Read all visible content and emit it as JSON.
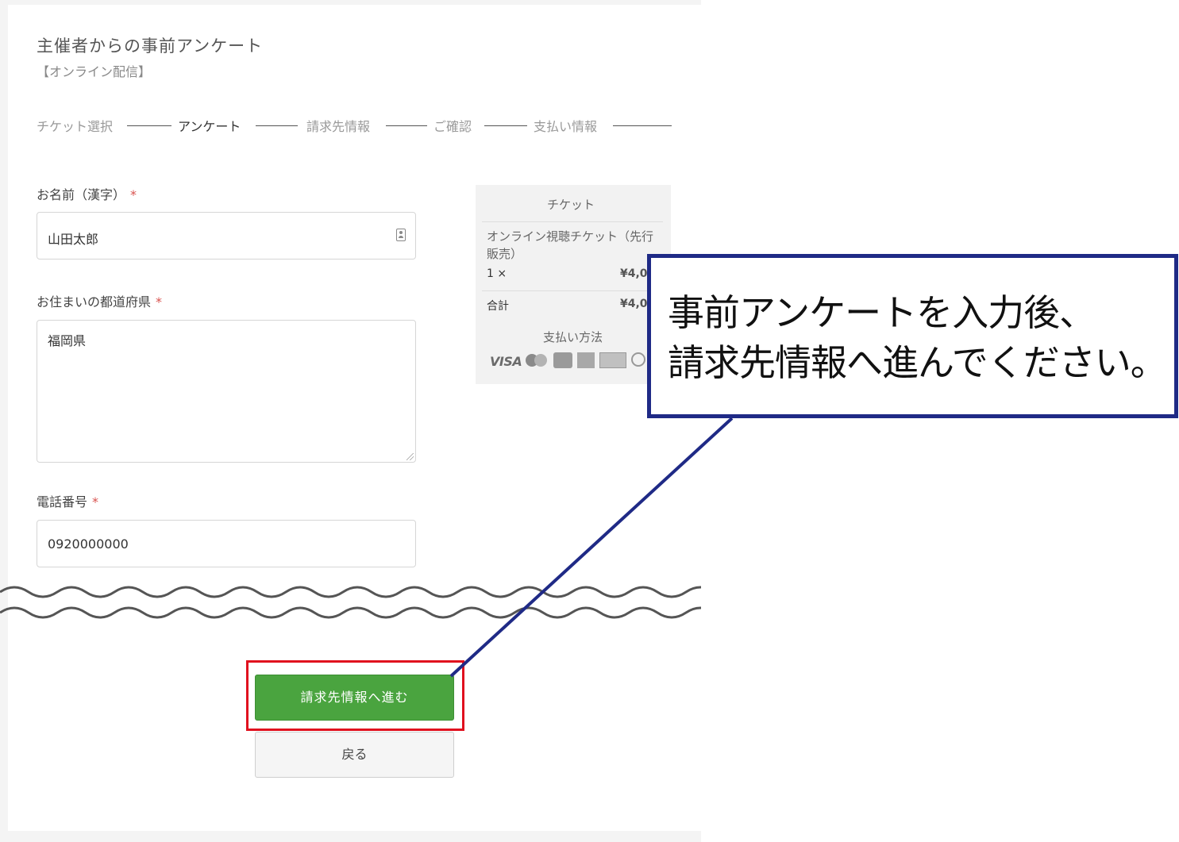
{
  "event": {
    "title": "主催者からの事前アンケート",
    "subtitle": "【オンライン配信】"
  },
  "steps": [
    {
      "label": "チケット選択",
      "active": false
    },
    {
      "label": "アンケート",
      "active": true
    },
    {
      "label": "請求先情報",
      "active": false
    },
    {
      "label": "ご確認",
      "active": false
    },
    {
      "label": "支払い情報",
      "active": false
    }
  ],
  "form": {
    "name": {
      "label": "お名前（漢字）",
      "required_mark": "*",
      "value": "山田太郎"
    },
    "prefecture": {
      "label": "お住まいの都道府県",
      "required_mark": "*",
      "value": "福岡県"
    },
    "phone": {
      "label": "電話番号",
      "required_mark": "*",
      "value": "0920000000"
    }
  },
  "summary": {
    "heading": "チケット",
    "item_name": "オンライン視聴チケット（先行販売）",
    "quantity": "1 ×",
    "item_price": "¥4,0",
    "total_label": "合計",
    "total_price": "¥4,0",
    "payment_heading": "支払い方法",
    "payment_methods": {
      "visa": "VISA",
      "icons": [
        "mastercard-icon",
        "jcb-icon",
        "amex-icon",
        "discover-icon",
        "diners-icon"
      ]
    }
  },
  "buttons": {
    "next": "請求先情報へ進む",
    "back": "戻る"
  },
  "callout": {
    "line1": "事前アンケートを入力後、",
    "line2": "請求先情報へ進んでください。"
  },
  "colors": {
    "primary_button": "#4aa43f",
    "highlight_border": "#e0101e",
    "callout_border": "#1f2a86",
    "required_mark": "#d9534f"
  }
}
